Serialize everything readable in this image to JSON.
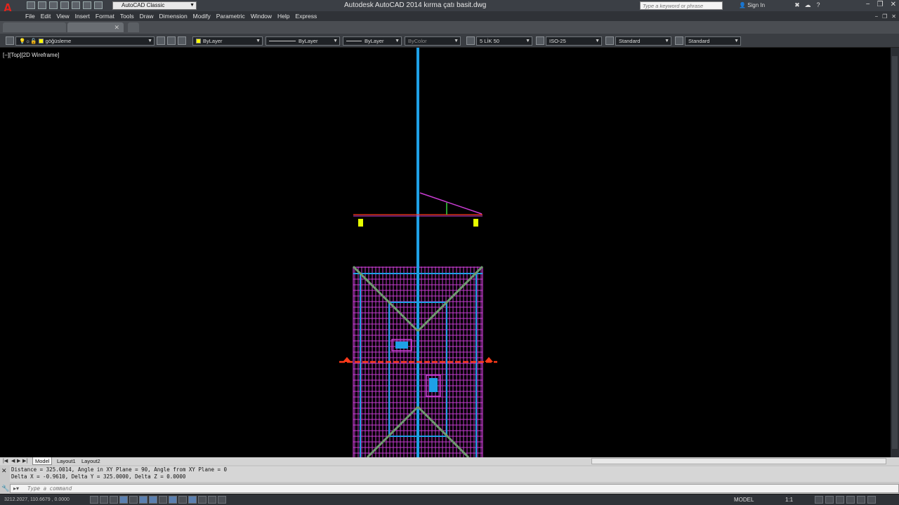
{
  "title_bar": {
    "workspace": "AutoCAD Classic",
    "window_title": "Autodesk AutoCAD 2014    kırma çatı basit.dwg",
    "search_placeholder": "Type a keyword or phrase",
    "sign_in": "Sign In"
  },
  "menu": [
    "File",
    "Edit",
    "View",
    "Insert",
    "Format",
    "Tools",
    "Draw",
    "Dimension",
    "Modify",
    "Parametric",
    "Window",
    "Help",
    "Express"
  ],
  "properties": {
    "layer": "göğüsleme",
    "color": "ByLayer",
    "linetype": "ByLayer",
    "lineweight": "ByLayer",
    "plotstyle": "ByColor",
    "text_style": "5 LİK 50",
    "dim_style": "ISO-25",
    "table_style": "Standard",
    "multileader_style": "Standard"
  },
  "viewport": {
    "label": "[−][Top][2D Wireframe]"
  },
  "layout_tabs": [
    "Model",
    "Layout1",
    "Layout2"
  ],
  "command": {
    "history_line1": "Distance = 325.0014,  Angle in XY Plane = 90,  Angle from XY Plane = 0",
    "history_line2": "Delta X = -0.9610,  Delta Y = 325.0000,   Delta Z = 0.0000",
    "placeholder": "Type a command"
  },
  "status": {
    "coords": "3212.2027, 110.6679 , 0.0000",
    "space": "MODEL",
    "scale": "1:1"
  },
  "colors": {
    "background": "#000000",
    "blue": "#1ea0e6",
    "magenta": "#c83cd2",
    "green": "#6f9a6f",
    "red": "#ff3a1a",
    "yellow": "#e6ff00"
  }
}
